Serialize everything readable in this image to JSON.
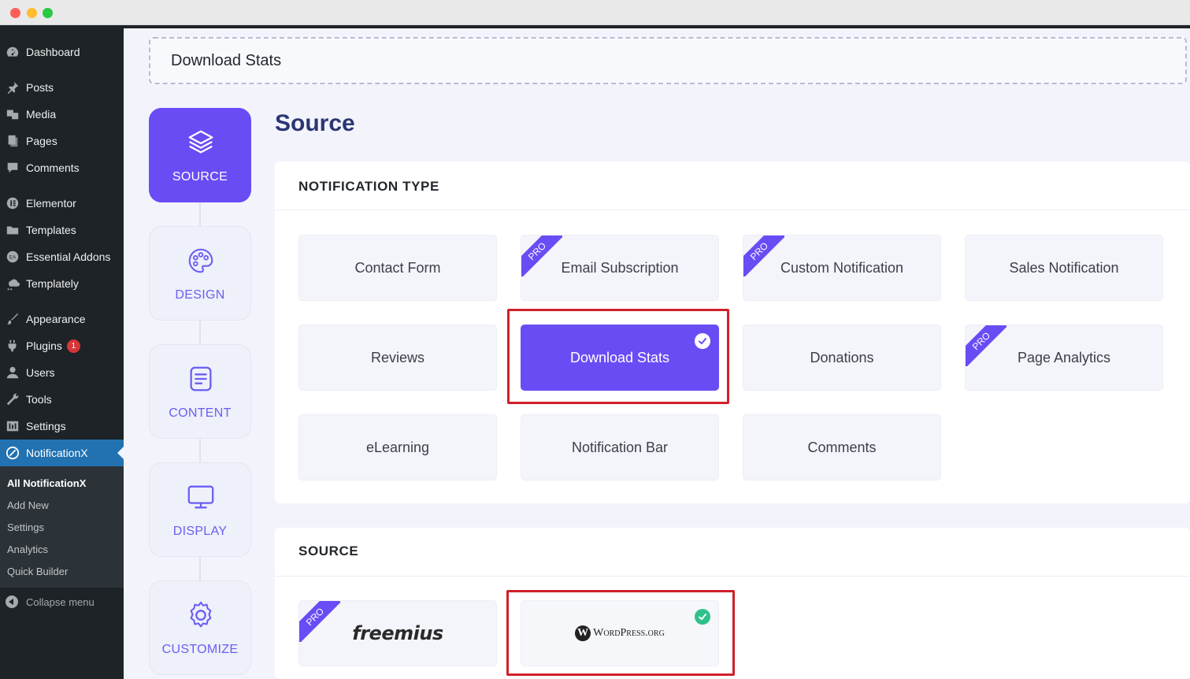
{
  "sidebar": {
    "items": [
      {
        "label": "Dashboard",
        "icon": "dashboard-icon"
      },
      {
        "label": "Posts",
        "icon": "pin-icon"
      },
      {
        "label": "Media",
        "icon": "media-icon"
      },
      {
        "label": "Pages",
        "icon": "pages-icon"
      },
      {
        "label": "Comments",
        "icon": "comment-icon"
      },
      {
        "label": "Elementor",
        "icon": "elementor-icon"
      },
      {
        "label": "Templates",
        "icon": "folder-icon"
      },
      {
        "label": "Essential Addons",
        "icon": "essential-addons-icon"
      },
      {
        "label": "Templately",
        "icon": "templately-icon"
      },
      {
        "label": "Appearance",
        "icon": "brush-icon"
      },
      {
        "label": "Plugins",
        "icon": "plugin-icon",
        "badge": "1"
      },
      {
        "label": "Users",
        "icon": "user-icon"
      },
      {
        "label": "Tools",
        "icon": "wrench-icon"
      },
      {
        "label": "Settings",
        "icon": "settings-icon"
      },
      {
        "label": "NotificationX",
        "icon": "notificationx-icon"
      }
    ],
    "submenu": [
      "All NotificationX",
      "Add New",
      "Settings",
      "Analytics",
      "Quick Builder"
    ],
    "collapse_label": "Collapse menu"
  },
  "title_input": {
    "value": "Download Stats"
  },
  "steps": [
    {
      "label": "SOURCE",
      "icon": "layers-icon"
    },
    {
      "label": "DESIGN",
      "icon": "palette-icon"
    },
    {
      "label": "CONTENT",
      "icon": "document-icon"
    },
    {
      "label": "DISPLAY",
      "icon": "monitor-icon"
    },
    {
      "label": "CUSTOMIZE",
      "icon": "gear-icon"
    }
  ],
  "heading": "Source",
  "notification_type": {
    "heading": "NOTIFICATION TYPE",
    "options": [
      {
        "label": "Contact Form",
        "pro": false
      },
      {
        "label": "Email Subscription",
        "pro": true
      },
      {
        "label": "Custom Notification",
        "pro": true
      },
      {
        "label": "Sales Notification",
        "pro": false
      },
      {
        "label": "Reviews",
        "pro": false
      },
      {
        "label": "Download Stats",
        "pro": false,
        "selected": true
      },
      {
        "label": "Donations",
        "pro": false
      },
      {
        "label": "Page Analytics",
        "pro": true
      },
      {
        "label": "eLearning",
        "pro": false
      },
      {
        "label": "Notification Bar",
        "pro": false
      },
      {
        "label": "Comments",
        "pro": false
      }
    ],
    "pro_label": "PRO"
  },
  "source": {
    "heading": "SOURCE",
    "options": [
      {
        "label": "freemius",
        "pro": true
      },
      {
        "label": "WordPress.org",
        "pro": false,
        "selected": true
      }
    ]
  },
  "colors": {
    "accent": "#6a4cf5",
    "highlight": "#d0202a",
    "wp_active": "#2271b1"
  }
}
